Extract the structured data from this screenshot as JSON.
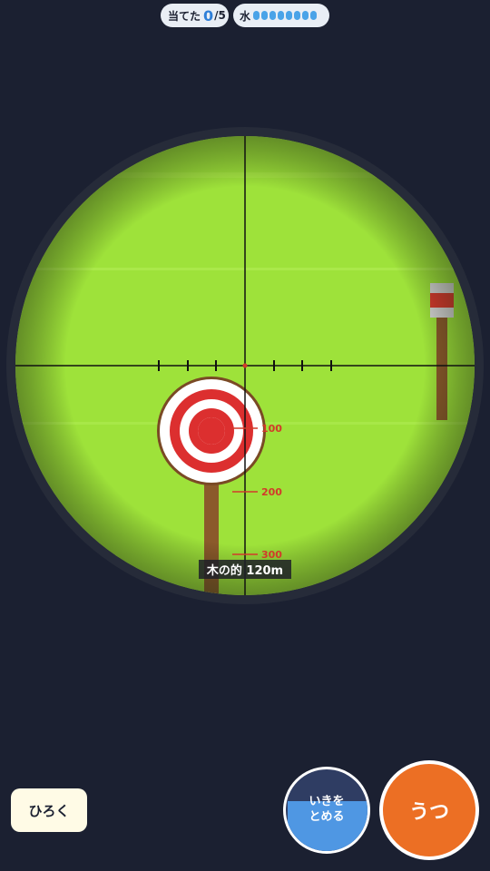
{
  "hud": {
    "hits_label": "当てた",
    "hits_value": "0",
    "hits_total": "/5",
    "water_label": "水",
    "water_level": 8,
    "water_color": "#4aa3e8"
  },
  "scope": {
    "target_label": "木の的 120m",
    "range_marks": [
      "100",
      "200",
      "300"
    ],
    "background_color": "#9ee23a",
    "reticle_mark_color": "#d23a2a"
  },
  "controls": {
    "zoom_label": "ひろく",
    "breath_label_line1": "いきを",
    "breath_label_line2": "とめる",
    "fire_label": "うつ",
    "fire_color": "#ec6f24"
  }
}
